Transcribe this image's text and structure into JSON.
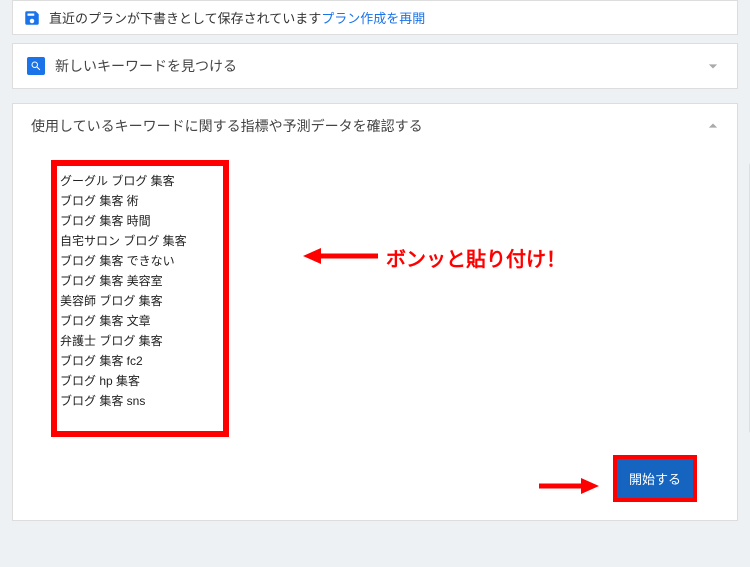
{
  "notice": {
    "text": "直近のプランが下書きとして保存されています ",
    "link": "プラン作成を再開"
  },
  "panel_collapsed": {
    "title": "新しいキーワードを見つける"
  },
  "panel_expanded": {
    "title": "使用しているキーワードに関する指標や予測データを確認する",
    "keywords": "グーグル ブログ 集客\nブログ 集客 術\nブログ 集客 時間\n自宅サロン ブログ 集客\nブログ 集客 できない\nブログ 集客 美容室\n美容師 ブログ 集客\nブログ 集客 文章\n弁護士 ブログ 集客\nブログ 集客 fc2\nブログ hp 集客\nブログ 集客 sns",
    "start_button": "開始する"
  },
  "annotation": {
    "paste_label": "ボンッと貼り付け！"
  }
}
